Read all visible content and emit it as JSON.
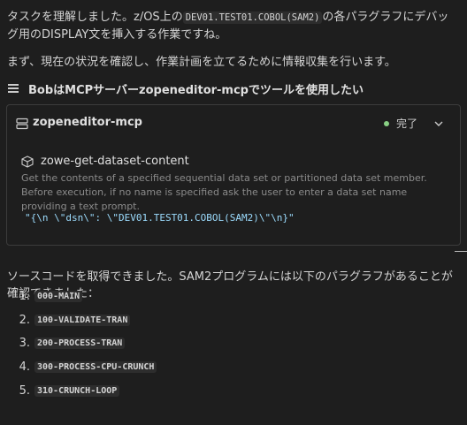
{
  "messages": {
    "intro_p1": [
      "タスクを理解しました。z/OS上の",
      "DEV01.TEST01.COBOL(SAM2)",
      "の各パラグラフにデバッグ用のDISPLAY文を挿入する作業ですね。"
    ],
    "intro_p2": "まず、現在の状況を確認し、作業計画を立てるために情報収集を行います。",
    "result_p": "ソースコードを取得できました。SAM2プログラムには以下のパラグラフがあることが確認できました："
  },
  "tool_use": {
    "header_label": "BobはMCPサーバーzopeneditor-mcpでツールを使用したい",
    "server_name": "zopeneditor-mcp",
    "status": "完了",
    "status_color": "#89d185",
    "tool_name": "zowe-get-dataset-content",
    "tool_description": "Get the contents of a specified sequential data set or partitioned data set member. Before execution, if no name is specified ask the user to enter a data set name providing a text prompt.",
    "arguments": "\"{\\n  \\\"dsn\\\": \\\"DEV01.TEST01.COBOL(SAM2)\\\"\\n}\""
  },
  "paragraphs": [
    {
      "num": "1.",
      "name": "000-MAIN"
    },
    {
      "num": "2.",
      "name": "100-VALIDATE-TRAN"
    },
    {
      "num": "3.",
      "name": "200-PROCESS-TRAN"
    },
    {
      "num": "4.",
      "name": "300-PROCESS-CPU-CRUNCH"
    },
    {
      "num": "5.",
      "name": "310-CRUNCH-LOOP"
    }
  ],
  "icons": {
    "tool_header": "list-icon",
    "server": "server-icon",
    "tool": "cube-icon",
    "expand": "chevron-down-icon"
  }
}
